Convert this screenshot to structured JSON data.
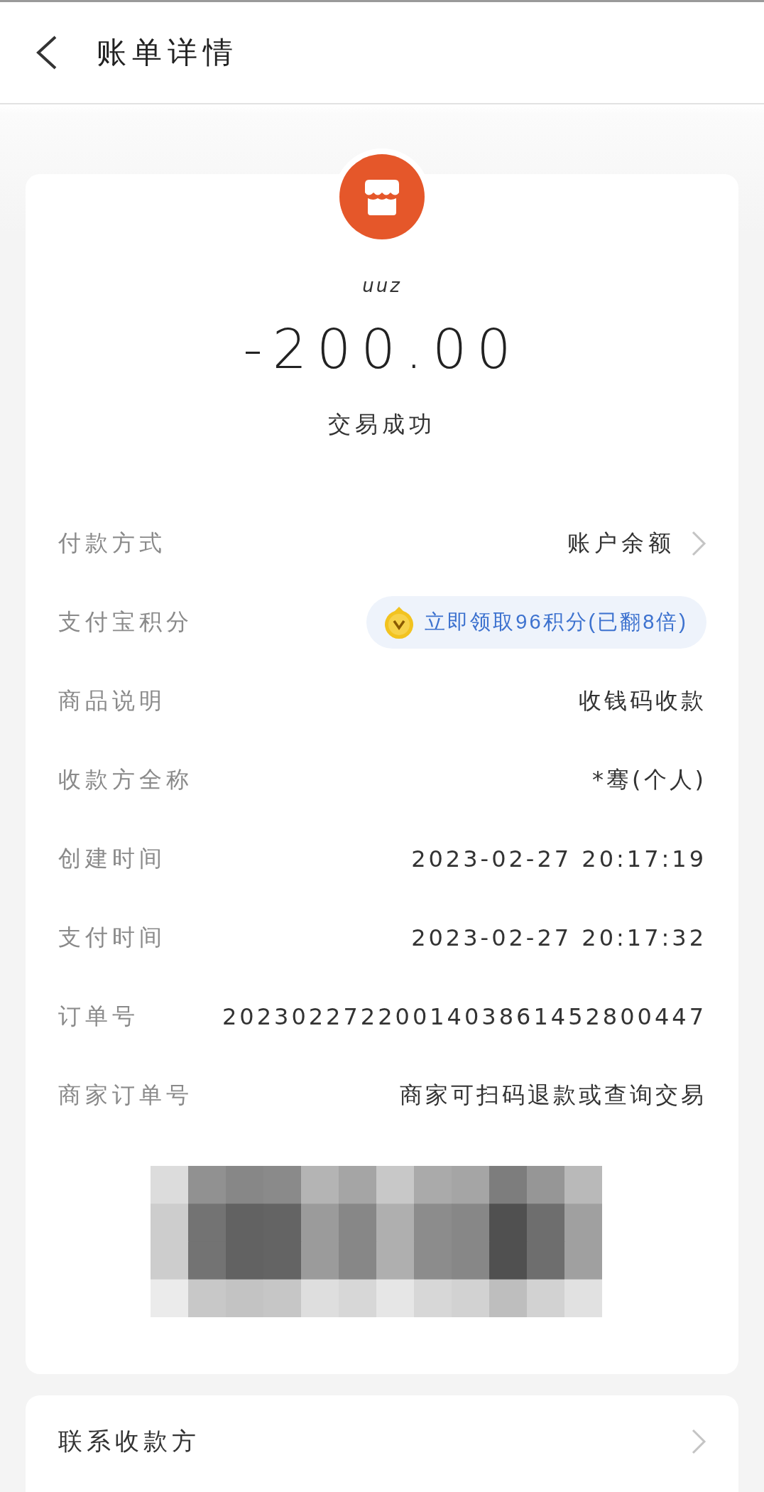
{
  "header": {
    "title": "账单详情"
  },
  "summary": {
    "merchant": "uuz",
    "amount": "-200.00",
    "status": "交易成功"
  },
  "rows": [
    {
      "label": "付款方式",
      "value": "账户余额",
      "kind": "link"
    },
    {
      "label": "支付宝积分",
      "value": "立即领取96积分(已翻8倍)",
      "kind": "badge"
    },
    {
      "label": "商品说明",
      "value": "收钱码收款",
      "kind": "text"
    },
    {
      "label": "收款方全称",
      "value": "*骞(个人)",
      "kind": "text"
    },
    {
      "label": "创建时间",
      "value": "2023-02-27 20:17:19",
      "kind": "text"
    },
    {
      "label": "支付时间",
      "value": "2023-02-27 20:17:32",
      "kind": "text"
    },
    {
      "label": "订单号",
      "value": "2023022722001403861452800447",
      "kind": "text"
    },
    {
      "label": "商家订单号",
      "value": "商家可扫码退款或查询交易",
      "kind": "text"
    }
  ],
  "contact": {
    "label": "联系收款方"
  }
}
